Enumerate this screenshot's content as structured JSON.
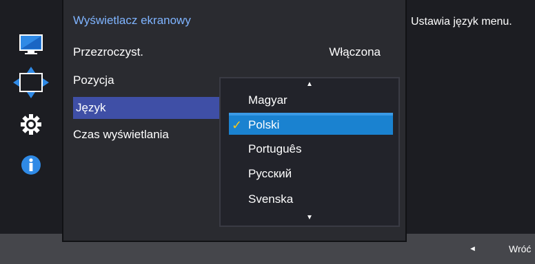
{
  "sidebar": {
    "icons": [
      {
        "name": "monitor-icon"
      },
      {
        "name": "position-arrows-icon"
      },
      {
        "name": "gear-icon"
      },
      {
        "name": "info-icon"
      }
    ]
  },
  "menu": {
    "title": "Wyświetlacz ekranowy",
    "items": [
      {
        "label": "Przezroczyst.",
        "value": "Włączona"
      },
      {
        "label": "Pozycja"
      },
      {
        "label": "Język",
        "selected": true
      },
      {
        "label": "Czas wyświetlania"
      }
    ]
  },
  "dropdown": {
    "up_arrow": "▲",
    "down_arrow": "▼",
    "options": [
      {
        "label": "Magyar"
      },
      {
        "label": "Polski",
        "selected": true,
        "check": "✓"
      },
      {
        "label": "Português"
      },
      {
        "label": "Русский"
      },
      {
        "label": "Svenska"
      }
    ]
  },
  "help": {
    "text": "Ustawia język menu."
  },
  "bottom": {
    "back_arrow": "◄",
    "back_label": "Wróć"
  },
  "colors": {
    "title_accent": "#7fb4ff",
    "menu_selected": "#3f4fa6",
    "option_selected": "#1a82d0",
    "check": "#f4c81f"
  }
}
